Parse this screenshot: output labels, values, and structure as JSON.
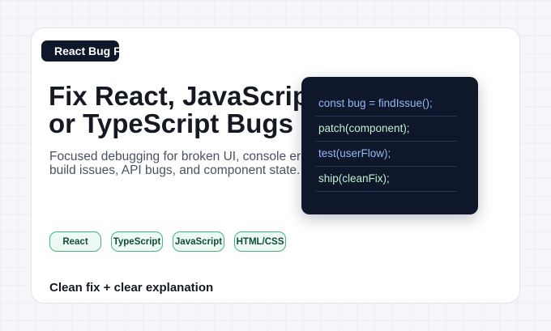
{
  "badge": {
    "label": "React Bug Fix"
  },
  "headline": {
    "line1": "Fix React, JavaScript",
    "line2": "or TypeScript Bugs"
  },
  "description": {
    "line1": "Focused debugging for broken UI, console errors,",
    "line2": "build issues, API bugs, and component state."
  },
  "chips": [
    "React",
    "TypeScript",
    "JavaScript",
    "HTML/CSS"
  ],
  "tagline": "Clean fix + clear explanation",
  "code_panel": {
    "lines": [
      "const bug = findIssue();",
      "patch(component);",
      "test(userFlow);",
      "ship(cleanFix);"
    ]
  },
  "colors": {
    "dark_navy": "#0f172a",
    "chip_border": "#45b386",
    "chip_fill": "#ecfaf3",
    "code_blue": "#93b8f3",
    "code_green": "#bff0cf"
  }
}
